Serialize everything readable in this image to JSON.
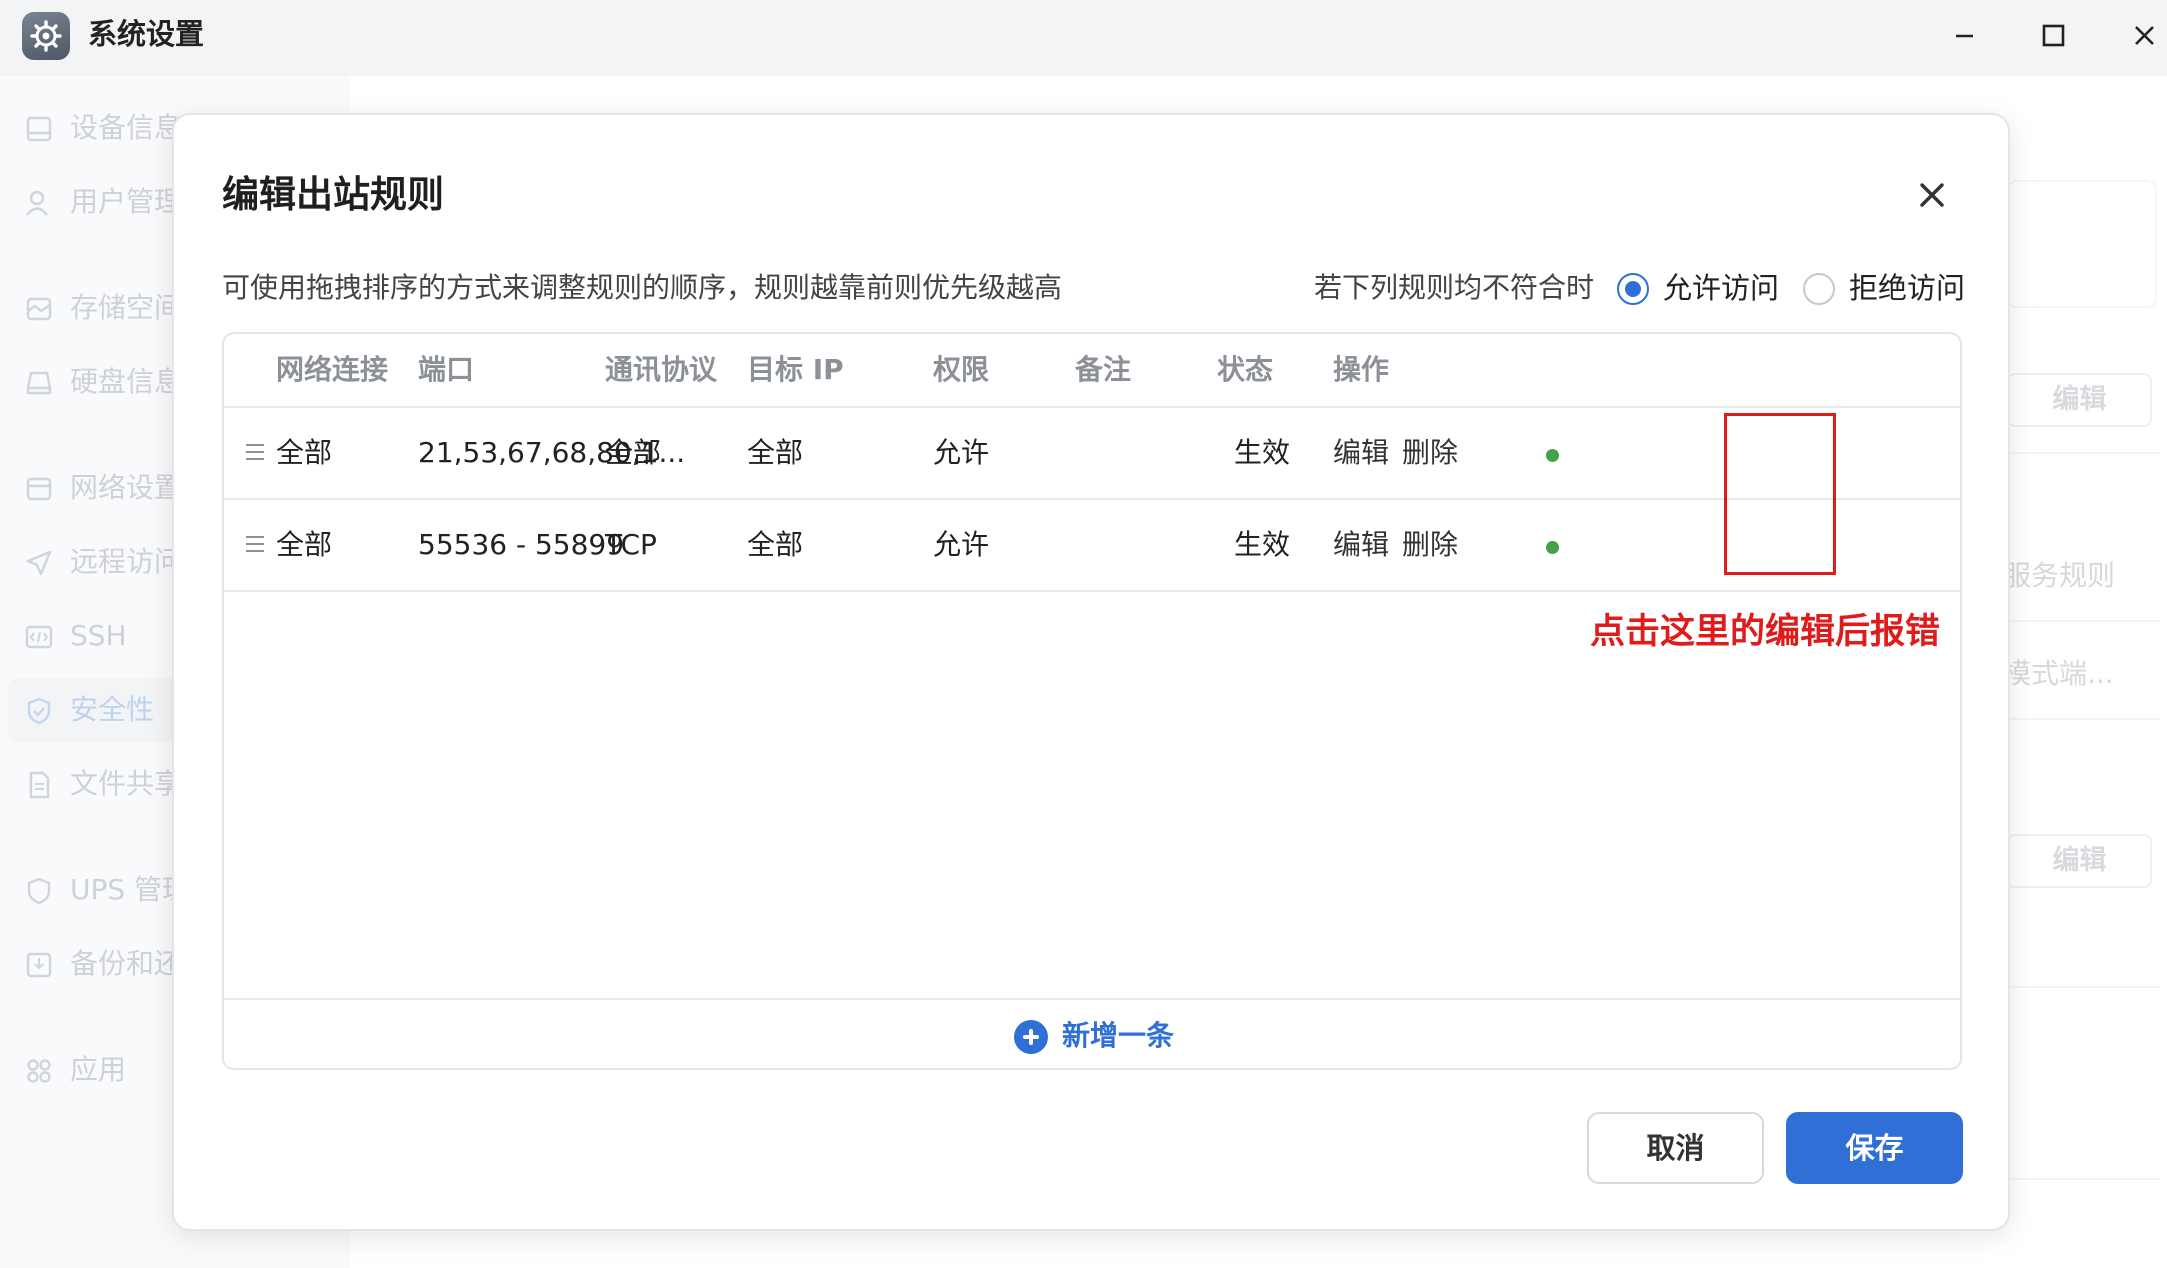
{
  "window": {
    "title": "系统设置",
    "icons": {
      "app": "gear-icon",
      "minimize": "minimize-icon",
      "maximize": "maximize-icon",
      "close": "close-icon"
    }
  },
  "sidebar": {
    "items": [
      {
        "label": "设备信息",
        "icon": "device-icon",
        "active": false
      },
      {
        "label": "用户管理",
        "icon": "user-icon",
        "active": false
      },
      {
        "label": "存储空间",
        "icon": "storage-icon",
        "active": false
      },
      {
        "label": "硬盘信息",
        "icon": "disk-icon",
        "active": false
      },
      {
        "label": "网络设置",
        "icon": "network-icon",
        "active": false
      },
      {
        "label": "远程访问",
        "icon": "send-icon",
        "active": false
      },
      {
        "label": "SSH",
        "icon": "code-icon",
        "active": false
      },
      {
        "label": "安全性",
        "icon": "shield-icon",
        "active": true
      },
      {
        "label": "文件共享",
        "icon": "file-icon",
        "active": false
      },
      {
        "label": "UPS 管理",
        "icon": "ups-icon",
        "active": false
      },
      {
        "label": "备份和还原",
        "icon": "backup-icon",
        "active": false
      },
      {
        "label": "应用",
        "icon": "apps-icon",
        "active": false
      }
    ]
  },
  "background": {
    "edit_label_1": "编辑",
    "service_rules_text": "服务规则",
    "mode_text": "模式端...",
    "edit_label_2": "编辑"
  },
  "dialog": {
    "title": "编辑出站规则",
    "hint": "可使用拖拽排序的方式来调整规则的顺序，规则越靠前则优先级越高",
    "policy_label": "若下列规则均不符合时",
    "options": [
      {
        "label": "允许访问",
        "checked": true
      },
      {
        "label": "拒绝访问",
        "checked": false
      }
    ],
    "table": {
      "headers": [
        "网络连接",
        "端口",
        "通讯协议",
        "目标 IP",
        "权限",
        "备注",
        "状态",
        "操作"
      ],
      "rows": [
        {
          "network": "全部",
          "port": "21,53,67,68,80,1...",
          "protocol": "全部",
          "target_ip": "全部",
          "permission": "允许",
          "note": "",
          "status": "生效",
          "edit": "编辑",
          "delete": "删除"
        },
        {
          "network": "全部",
          "port": "55536 - 55899",
          "protocol": "TCP",
          "target_ip": "全部",
          "permission": "允许",
          "note": "",
          "status": "生效",
          "edit": "编辑",
          "delete": "删除"
        }
      ],
      "add_label": "新增一条"
    },
    "annotation": "点击这里的编辑后报错",
    "cancel_label": "取消",
    "save_label": "保存"
  },
  "colors": {
    "accent": "#2f6fd6",
    "status_active": "#45a04a",
    "annotation": "#e01b1b"
  }
}
